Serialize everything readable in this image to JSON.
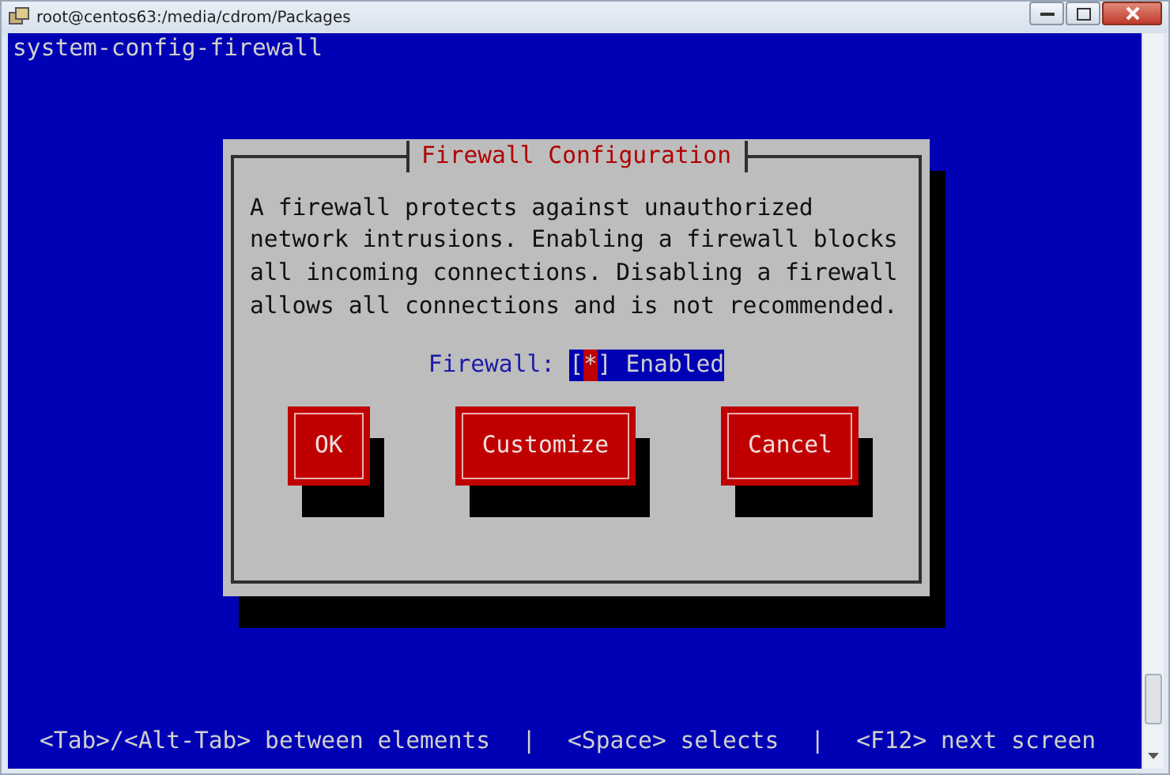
{
  "window": {
    "title": "root@centos63:/media/cdrom/Packages"
  },
  "terminal": {
    "header": "system-config-firewall"
  },
  "dialog": {
    "title": "Firewall Configuration",
    "message": "A firewall protects against unauthorized network intrusions. Enabling a firewall blocks all incoming connections. Disabling a firewall allows all connections and is not recommended.",
    "field_label": "Firewall:",
    "checkbox": {
      "open": "[",
      "mark": "*",
      "close": "]",
      "label": "Enabled",
      "checked": true
    },
    "buttons": [
      {
        "label": "OK"
      },
      {
        "label": "Customize"
      },
      {
        "label": "Cancel"
      }
    ]
  },
  "status_bar": {
    "items": [
      "<Tab>/<Alt-Tab> between elements",
      "<Space> selects",
      "<F12> next screen"
    ],
    "separator": "|"
  }
}
